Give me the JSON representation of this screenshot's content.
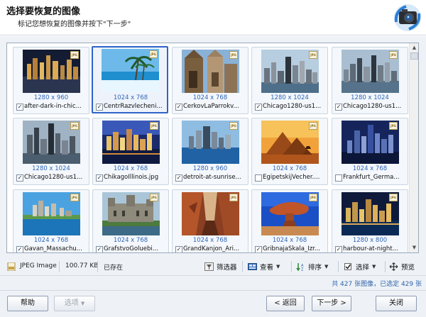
{
  "header": {
    "title": "选择要恢复的图像",
    "subtitle": "标记您想恢复的图像并按下\"下一步\""
  },
  "gallery": {
    "badge": "JPG",
    "items": [
      {
        "name": "after-dark-in-chic...",
        "dims": "1280 x 960",
        "checked": true
      },
      {
        "name": "CentrRazvlecheni...",
        "dims": "1024 x 768",
        "checked": true
      },
      {
        "name": "CerkovLaParrokv...",
        "dims": "1024 x 768",
        "checked": true
      },
      {
        "name": "Chicago1280-us1...",
        "dims": "1280 x 1024",
        "checked": true
      },
      {
        "name": "Chicago1280-us1...",
        "dims": "1280 x 1024",
        "checked": true
      },
      {
        "name": "Chicago1280-us1...",
        "dims": "1280 x 1024",
        "checked": true
      },
      {
        "name": "ChikagoIllinois.jpg",
        "dims": "1024 x 768",
        "checked": true
      },
      {
        "name": "detroit-at-sunrise...",
        "dims": "1280 x 960",
        "checked": true
      },
      {
        "name": "EgipetskijVecher....",
        "dims": "1024 x 768",
        "checked": false
      },
      {
        "name": "Frankfurt_Germa...",
        "dims": "1024 x 768",
        "checked": false
      },
      {
        "name": "Gavan_Massachu...",
        "dims": "1024 x 768",
        "checked": true
      },
      {
        "name": "GrafstvoGoluebi...",
        "dims": "1024 x 768",
        "checked": true
      },
      {
        "name": "GrandKanjon_Ari...",
        "dims": "1024 x 768",
        "checked": true
      },
      {
        "name": "GribnajaSkala_Izr...",
        "dims": "1024 x 768",
        "checked": true
      },
      {
        "name": "harbour-at-night...",
        "dims": "1280 x 800",
        "checked": true
      }
    ]
  },
  "info": {
    "type": "JPEG Image",
    "size": "100.77 KB",
    "state": "已存在"
  },
  "toolbar": {
    "filter": "筛选器",
    "view": "查看",
    "sort": "排序",
    "select": "选择",
    "preview": "预览"
  },
  "status": "共 427 张图像，已选定 429 张",
  "buttons": {
    "help": "帮助",
    "options": "选项",
    "back": "< 返回",
    "next": "下一步 >",
    "close": "关闭"
  }
}
